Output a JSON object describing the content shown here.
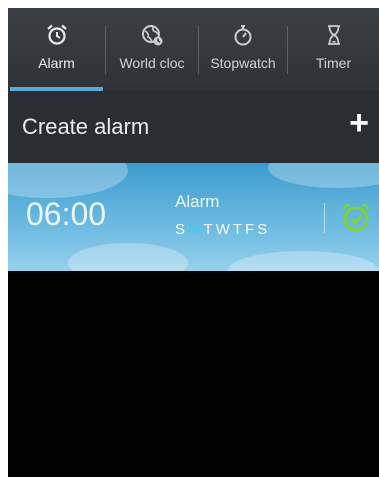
{
  "tabs": [
    {
      "label": "Alarm",
      "icon": "alarm-clock-icon",
      "selected": true
    },
    {
      "label": "World cloc",
      "icon": "globe-icon",
      "selected": false
    },
    {
      "label": "Stopwatch",
      "icon": "stopwatch-icon",
      "selected": false
    },
    {
      "label": "Timer",
      "icon": "hourglass-icon",
      "selected": false
    }
  ],
  "create": {
    "label": "Create alarm",
    "add_icon": "plus-icon"
  },
  "alarm": {
    "time": "06:00",
    "name": "Alarm",
    "days": [
      {
        "letter": "S",
        "active": false
      },
      {
        "letter": "M",
        "active": true
      },
      {
        "letter": "T",
        "active": false
      },
      {
        "letter": "W",
        "active": false
      },
      {
        "letter": "T",
        "active": false
      },
      {
        "letter": "F",
        "active": false
      },
      {
        "letter": "S",
        "active": false
      }
    ],
    "toggle_icon": "alarm-on-icon"
  },
  "colors": {
    "accent": "#5aa9d4",
    "active_day": "#43c6f3",
    "alarm_on": "#7ed33b"
  }
}
